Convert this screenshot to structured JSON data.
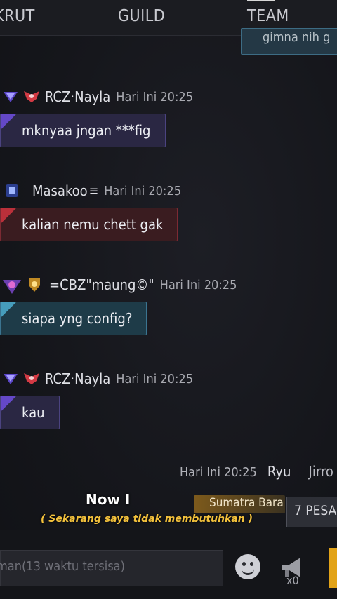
{
  "tabs": {
    "left": "KRUT",
    "mid": "GUILD",
    "right": "TEAM"
  },
  "top_bubble_text": "gimna nih g",
  "messages": [
    {
      "name": "RCZ·Nayla",
      "time": "Hari Ini 20:25",
      "text": "mknyaa jngan ***fig",
      "style": "purple"
    },
    {
      "name": "Masakoo",
      "time": "Hari Ini 20:25",
      "text": "kalian nemu chett gak",
      "style": "red"
    },
    {
      "name": "=CBZ\"maung©\"",
      "time": "Hari Ini 20:25",
      "text": "siapa yng config?",
      "style": "teal"
    },
    {
      "name": "RCZ·Nayla",
      "time": "Hari Ini 20:25",
      "text": "kau",
      "style": "purple"
    }
  ],
  "last_line": {
    "time": "Hari Ini 20:25",
    "name1": "Ryu",
    "name2": "Jirro"
  },
  "region_tag": "Sumatra Bara",
  "new_messages": "7 PESA",
  "subtitle_en": "Now I",
  "subtitle_id": "( Sekarang saya tidak membutuhkan )",
  "input": {
    "placeholder": "man(13 waktu tersisa)"
  },
  "horn_count": "x0",
  "colors": {
    "purple": "#4b4380",
    "red": "#7c2a33",
    "teal": "#3b7490",
    "subtitle": "#f4c23c",
    "send": "#e2a318"
  }
}
